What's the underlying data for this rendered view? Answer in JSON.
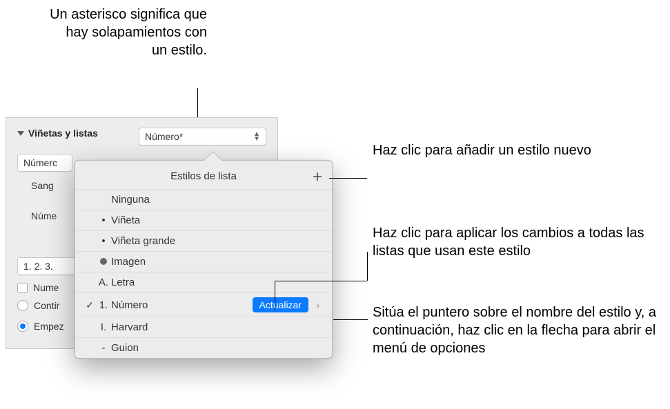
{
  "callouts": {
    "asterisk": "Un asterisco significa que hay solapamientos con un estilo.",
    "add_style": "Haz clic para añadir un estilo nuevo",
    "apply_all": "Haz clic para aplicar los cambios a todas las listas que usan este estilo",
    "hover_arrow": "Sitúa el puntero sobre el nombre del estilo y, a continuación, haz clic en la flecha para abrir el menú de opciones"
  },
  "inspector": {
    "section_title": "Viñetas y listas",
    "selected_style": "Número*",
    "type_dropdown": "Númerc",
    "indent_label": "Sang",
    "number_label": "Núme",
    "format": "1. 2. 3.",
    "order_checkbox": "Nume",
    "radio_continue": "Contir",
    "radio_start": "Empez"
  },
  "popover": {
    "title": "Estilos de lista",
    "items": [
      {
        "mark": "",
        "label": "Ninguna",
        "selected": false
      },
      {
        "mark": "•",
        "label": "Viñeta",
        "selected": false
      },
      {
        "mark": "•",
        "label": "Viñeta grande",
        "selected": false
      },
      {
        "mark": "img",
        "label": "Imagen",
        "selected": false
      },
      {
        "mark": "A.",
        "label": "Letra",
        "selected": false
      },
      {
        "mark": "1.",
        "label": "Número",
        "selected": true,
        "update": "Actualizar"
      },
      {
        "mark": "I.",
        "label": "Harvard",
        "selected": false
      },
      {
        "mark": "-",
        "label": "Guion",
        "selected": false
      }
    ]
  }
}
